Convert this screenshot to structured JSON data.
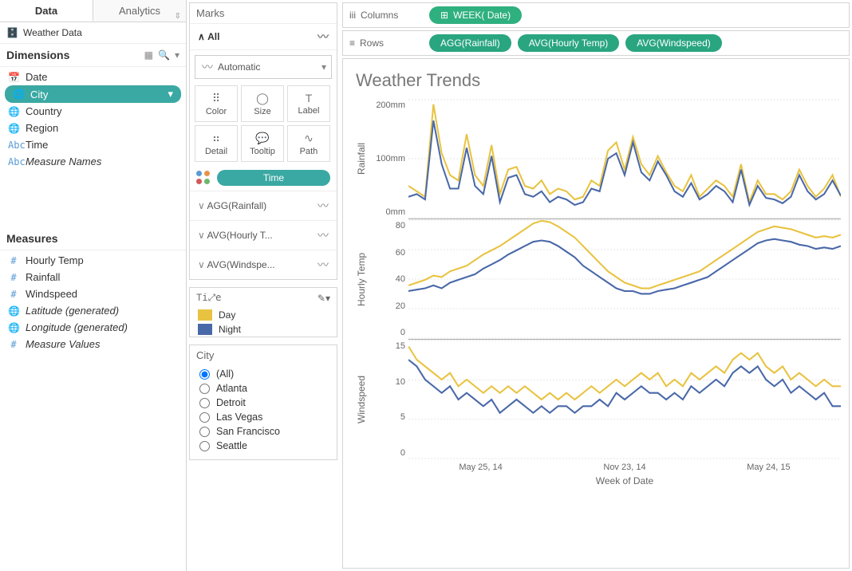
{
  "tabs": {
    "data": "Data",
    "analytics": "Analytics"
  },
  "datasource": {
    "name": "Weather Data"
  },
  "dimensions": {
    "title": "Dimensions",
    "items": [
      {
        "icon": "📅",
        "label": "Date"
      },
      {
        "icon": "🌐",
        "label": "City",
        "selected": true
      },
      {
        "icon": "🌐",
        "label": "Country"
      },
      {
        "icon": "🌐",
        "label": "Region"
      },
      {
        "icon": "Abc",
        "label": "Time"
      },
      {
        "icon": "Abc",
        "label": "Measure Names",
        "italic": true
      }
    ]
  },
  "measures": {
    "title": "Measures",
    "items": [
      {
        "icon": "#",
        "label": "Hourly Temp"
      },
      {
        "icon": "#",
        "label": "Rainfall"
      },
      {
        "icon": "#",
        "label": "Windspeed"
      },
      {
        "icon": "🌐",
        "label": "Latitude (generated)",
        "italic": true
      },
      {
        "icon": "🌐",
        "label": "Longitude (generated)",
        "italic": true
      },
      {
        "icon": "#",
        "label": "Measure Values",
        "italic": true
      }
    ]
  },
  "marks": {
    "title": "Marks",
    "all": "All",
    "type": "Automatic",
    "buttons": {
      "color": "Color",
      "size": "Size",
      "label": "Label",
      "detail": "Detail",
      "tooltip": "Tooltip",
      "path": "Path"
    },
    "color_pill": "Time",
    "subs": [
      {
        "label": "AGG(Rainfall)"
      },
      {
        "label": "AVG(Hourly T..."
      },
      {
        "label": "AVG(Windspe..."
      }
    ]
  },
  "legend": {
    "title": "Time",
    "items": [
      {
        "label": "Day",
        "color": "#e8c341"
      },
      {
        "label": "Night",
        "color": "#4968a8"
      }
    ]
  },
  "city_filter": {
    "title": "City",
    "options": [
      "(All)",
      "Atlanta",
      "Detroit",
      "Las Vegas",
      "San Francisco",
      "Seattle"
    ],
    "selected": "(All)"
  },
  "shelves": {
    "columns_label": "Columns",
    "rows_label": "Rows",
    "columns": [
      "WEEK( Date)"
    ],
    "rows": [
      "AGG(Rainfall)",
      "AVG(Hourly Temp)",
      "AVG(Windspeed)"
    ]
  },
  "viz_title": "Weather Trends",
  "xaxis": {
    "label": "Week of Date",
    "ticks": [
      "May 25, 14",
      "Nov 23, 14",
      "May 24, 15"
    ]
  },
  "chart_data": [
    {
      "type": "line",
      "ylabel": "Rainfall",
      "yticks": [
        "200mm",
        "100mm",
        "0mm"
      ],
      "ylim": [
        0,
        220
      ],
      "series": [
        {
          "name": "Day",
          "color": "#e8c341",
          "values": [
            60,
            50,
            40,
            210,
            120,
            80,
            70,
            155,
            80,
            60,
            135,
            45,
            90,
            95,
            60,
            55,
            70,
            45,
            55,
            50,
            35,
            40,
            70,
            60,
            125,
            140,
            90,
            150,
            100,
            80,
            115,
            85,
            60,
            50,
            80,
            40,
            55,
            70,
            60,
            40,
            100,
            30,
            70,
            45,
            45,
            35,
            50,
            90,
            60,
            40,
            55,
            80,
            40
          ]
        },
        {
          "name": "Night",
          "color": "#4968a8",
          "values": [
            40,
            45,
            35,
            180,
            100,
            55,
            55,
            130,
            60,
            45,
            115,
            30,
            75,
            80,
            45,
            40,
            50,
            30,
            40,
            35,
            25,
            30,
            55,
            50,
            110,
            120,
            80,
            140,
            85,
            70,
            105,
            80,
            50,
            40,
            65,
            35,
            45,
            60,
            50,
            30,
            90,
            25,
            60,
            38,
            35,
            28,
            40,
            80,
            50,
            35,
            45,
            70,
            42
          ]
        }
      ]
    },
    {
      "type": "line",
      "ylabel": "Hourly Temp",
      "yticks": [
        "80",
        "60",
        "40",
        "20",
        "0"
      ],
      "ylim": [
        0,
        85
      ],
      "series": [
        {
          "name": "Day",
          "color": "#e8c341",
          "values": [
            38,
            40,
            42,
            45,
            44,
            48,
            50,
            52,
            56,
            60,
            63,
            66,
            70,
            74,
            78,
            82,
            84,
            83,
            80,
            76,
            72,
            66,
            60,
            54,
            48,
            44,
            40,
            38,
            36,
            36,
            38,
            40,
            42,
            44,
            46,
            48,
            52,
            56,
            60,
            64,
            68,
            72,
            76,
            78,
            80,
            79,
            78,
            76,
            74,
            72,
            73,
            72,
            74
          ]
        },
        {
          "name": "Night",
          "color": "#4968a8",
          "values": [
            34,
            35,
            36,
            38,
            36,
            40,
            42,
            44,
            46,
            50,
            53,
            56,
            60,
            63,
            66,
            69,
            70,
            69,
            66,
            62,
            58,
            52,
            48,
            44,
            40,
            36,
            34,
            34,
            32,
            32,
            34,
            35,
            36,
            38,
            40,
            42,
            44,
            48,
            52,
            56,
            60,
            64,
            68,
            70,
            71,
            70,
            69,
            67,
            66,
            64,
            65,
            64,
            66
          ]
        }
      ]
    },
    {
      "type": "line",
      "ylabel": "Windspeed",
      "yticks": [
        "15",
        "10",
        "5",
        "0"
      ],
      "ylim": [
        0,
        18
      ],
      "series": [
        {
          "name": "Day",
          "color": "#e8c341",
          "values": [
            17,
            15,
            14,
            13,
            12,
            13,
            11,
            12,
            11,
            10,
            11,
            10,
            11,
            10,
            11,
            10,
            9,
            10,
            9,
            10,
            9,
            10,
            11,
            10,
            11,
            12,
            11,
            12,
            13,
            12,
            13,
            11,
            12,
            11,
            13,
            12,
            13,
            14,
            13,
            15,
            16,
            15,
            16,
            14,
            13,
            14,
            12,
            13,
            12,
            11,
            12,
            11,
            11
          ]
        },
        {
          "name": "Night",
          "color": "#4968a8",
          "values": [
            15,
            14,
            12,
            11,
            10,
            11,
            9,
            10,
            9,
            8,
            9,
            7,
            8,
            9,
            8,
            7,
            8,
            7,
            8,
            8,
            7,
            8,
            8,
            9,
            8,
            10,
            9,
            10,
            11,
            10,
            10,
            9,
            10,
            9,
            11,
            10,
            11,
            12,
            11,
            13,
            14,
            13,
            14,
            12,
            11,
            12,
            10,
            11,
            10,
            9,
            10,
            8,
            8
          ]
        }
      ]
    }
  ]
}
